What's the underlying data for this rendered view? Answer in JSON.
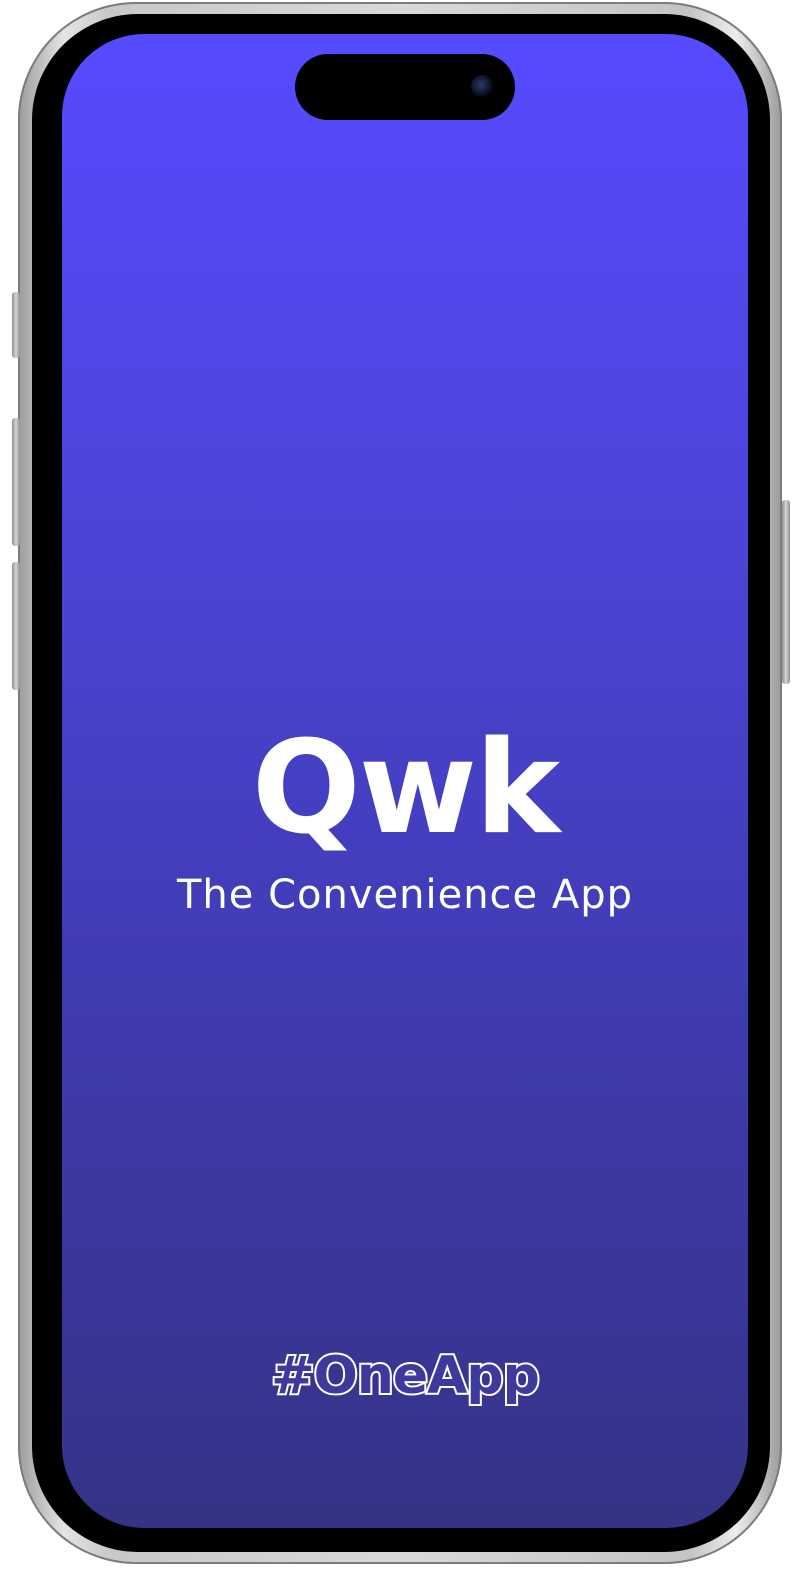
{
  "splash": {
    "logo": "Qwk",
    "tagline": "The Convenience App",
    "hashtag": "#OneApp"
  },
  "colors": {
    "gradient_top": "#564bff",
    "gradient_bottom": "#343385",
    "text": "#ffffff"
  }
}
